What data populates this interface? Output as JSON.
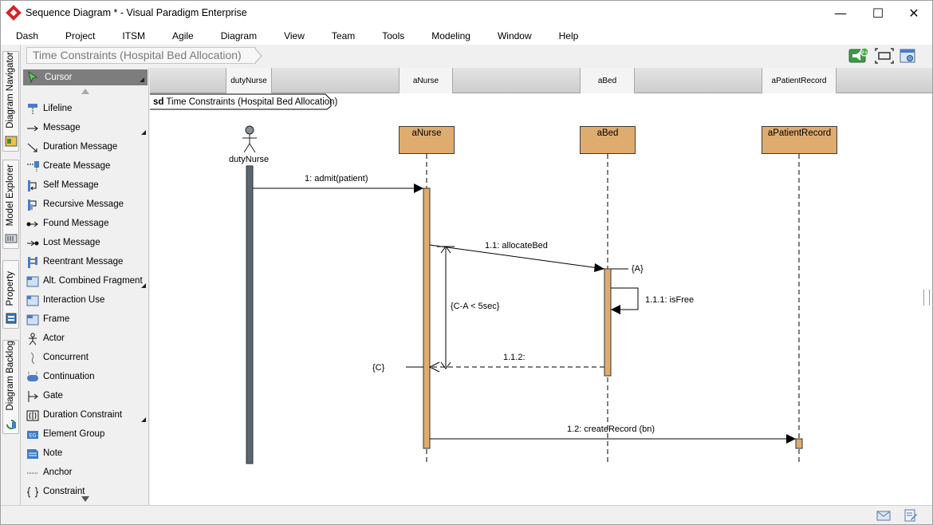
{
  "window": {
    "title": "Sequence Diagram * - Visual Paradigm Enterprise",
    "minimize_glyph": "—",
    "maximize_glyph": "☐",
    "close_glyph": "✕"
  },
  "menu": [
    "Dash",
    "Project",
    "ITSM",
    "Agile",
    "Diagram",
    "View",
    "Team",
    "Tools",
    "Modeling",
    "Window",
    "Help"
  ],
  "side_tabs": [
    "Diagram Navigator",
    "Model Explorer",
    "Property",
    "Diagram Backlog"
  ],
  "breadcrumb": "Time Constraints (Hospital Bed Allocation)",
  "toolbar": {
    "notification_badge": "9+"
  },
  "palette": {
    "items": [
      "Cursor",
      "Lifeline",
      "Message",
      "Duration Message",
      "Create Message",
      "Self Message",
      "Recursive Message",
      "Found Message",
      "Lost Message",
      "Reentrant Message",
      "Alt. Combined Fragment",
      "Interaction Use",
      "Frame",
      "Actor",
      "Concurrent",
      "Continuation",
      "Gate",
      "Duration Constraint",
      "Element Group",
      "Note",
      "Anchor",
      "Constraint"
    ],
    "icon_badge": "EG"
  },
  "diagram": {
    "frame_keyword": "sd",
    "frame_name": "Time Constraints (Hospital Bed Allocation)",
    "header_cells": [
      "dutyNurse",
      "aNurse",
      "aBed",
      "aPatientRecord"
    ],
    "actor": "dutyNurse",
    "lifelines": [
      "aNurse",
      "aBed",
      "aPatientRecord"
    ],
    "messages": {
      "m1": "1: admit(patient)",
      "m11": "1.1: allocateBed",
      "m111": "1.1.1: isFree",
      "m112": "1.1.2:",
      "m12": "1.2: createRecord (bn)"
    },
    "marks": {
      "a": "{A}",
      "c": "{C}"
    },
    "constraint": "{C-A < 5sec}"
  },
  "colors": {
    "lifeline_fill": "#dfac70",
    "actor_bar": "#5a6670",
    "accent_red": "#d6242c"
  }
}
